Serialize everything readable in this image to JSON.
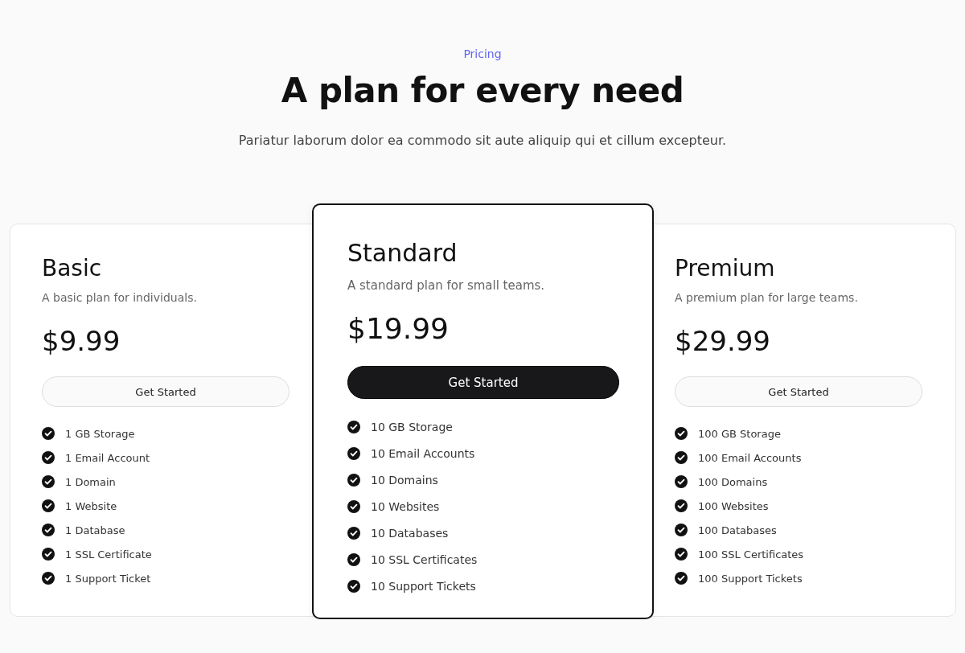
{
  "header": {
    "eyebrow": "Pricing",
    "title": "A plan for every need",
    "subtitle": "Pariatur laborum dolor ea commodo sit aute aliquip qui et cillum excepteur."
  },
  "plans": [
    {
      "name": "Basic",
      "description": "A basic plan for individuals.",
      "price": "$9.99",
      "button": "Get Started",
      "featured": false,
      "features": [
        "1 GB Storage",
        "1 Email Account",
        "1 Domain",
        "1 Website",
        "1 Database",
        "1 SSL Certificate",
        "1 Support Ticket"
      ]
    },
    {
      "name": "Standard",
      "description": "A standard plan for small teams.",
      "price": "$19.99",
      "button": "Get Started",
      "featured": true,
      "features": [
        "10 GB Storage",
        "10 Email Accounts",
        "10 Domains",
        "10 Websites",
        "10 Databases",
        "10 SSL Certificates",
        "10 Support Tickets"
      ]
    },
    {
      "name": "Premium",
      "description": "A premium plan for large teams.",
      "price": "$29.99",
      "button": "Get Started",
      "featured": false,
      "features": [
        "100 GB Storage",
        "100 Email Accounts",
        "100 Domains",
        "100 Websites",
        "100 Databases",
        "100 SSL Certificates",
        "100 Support Tickets"
      ]
    }
  ]
}
